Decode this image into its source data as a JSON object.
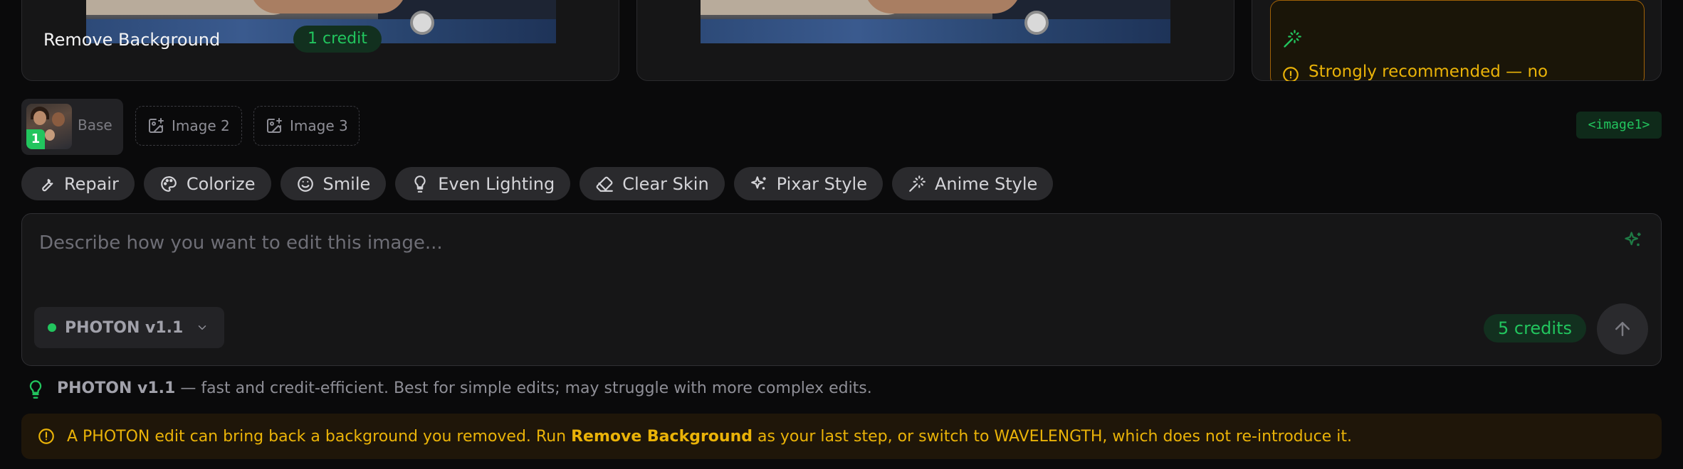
{
  "remove_bg": {
    "title": "Remove Background",
    "credit": "1 credit",
    "note": "Strongly recommended — no"
  },
  "thumbs": {
    "base_label": "Base",
    "base_badge": "1",
    "slot2": "Image 2",
    "slot3": "Image 3",
    "tag": "<image1>"
  },
  "chips": [
    {
      "label": "Repair",
      "icon": "wrench-icon"
    },
    {
      "label": "Colorize",
      "icon": "palette-icon"
    },
    {
      "label": "Smile",
      "icon": "smile-icon"
    },
    {
      "label": "Even Lighting",
      "icon": "lightbulb-icon"
    },
    {
      "label": "Clear Skin",
      "icon": "eraser-icon"
    },
    {
      "label": "Pixar Style",
      "icon": "sparkles-icon"
    },
    {
      "label": "Anime Style",
      "icon": "wand-icon"
    }
  ],
  "prompt": {
    "placeholder": "Describe how you want to edit this image...",
    "model": "PHOTON v1.1",
    "credits": "5 credits"
  },
  "hint": {
    "model": "PHOTON v1.1",
    "text": " — fast and credit-efficient. Best for simple edits; may struggle with more complex edits."
  },
  "warning": {
    "before": "A PHOTON edit can bring back a background you removed. Run ",
    "bold": "Remove Background",
    "after": " as your last step, or switch to WAVELENGTH, which does not re-introduce it."
  },
  "colors": {
    "accent": "#22c55e",
    "warning": "#eab308",
    "background": "#0a0a0b"
  }
}
